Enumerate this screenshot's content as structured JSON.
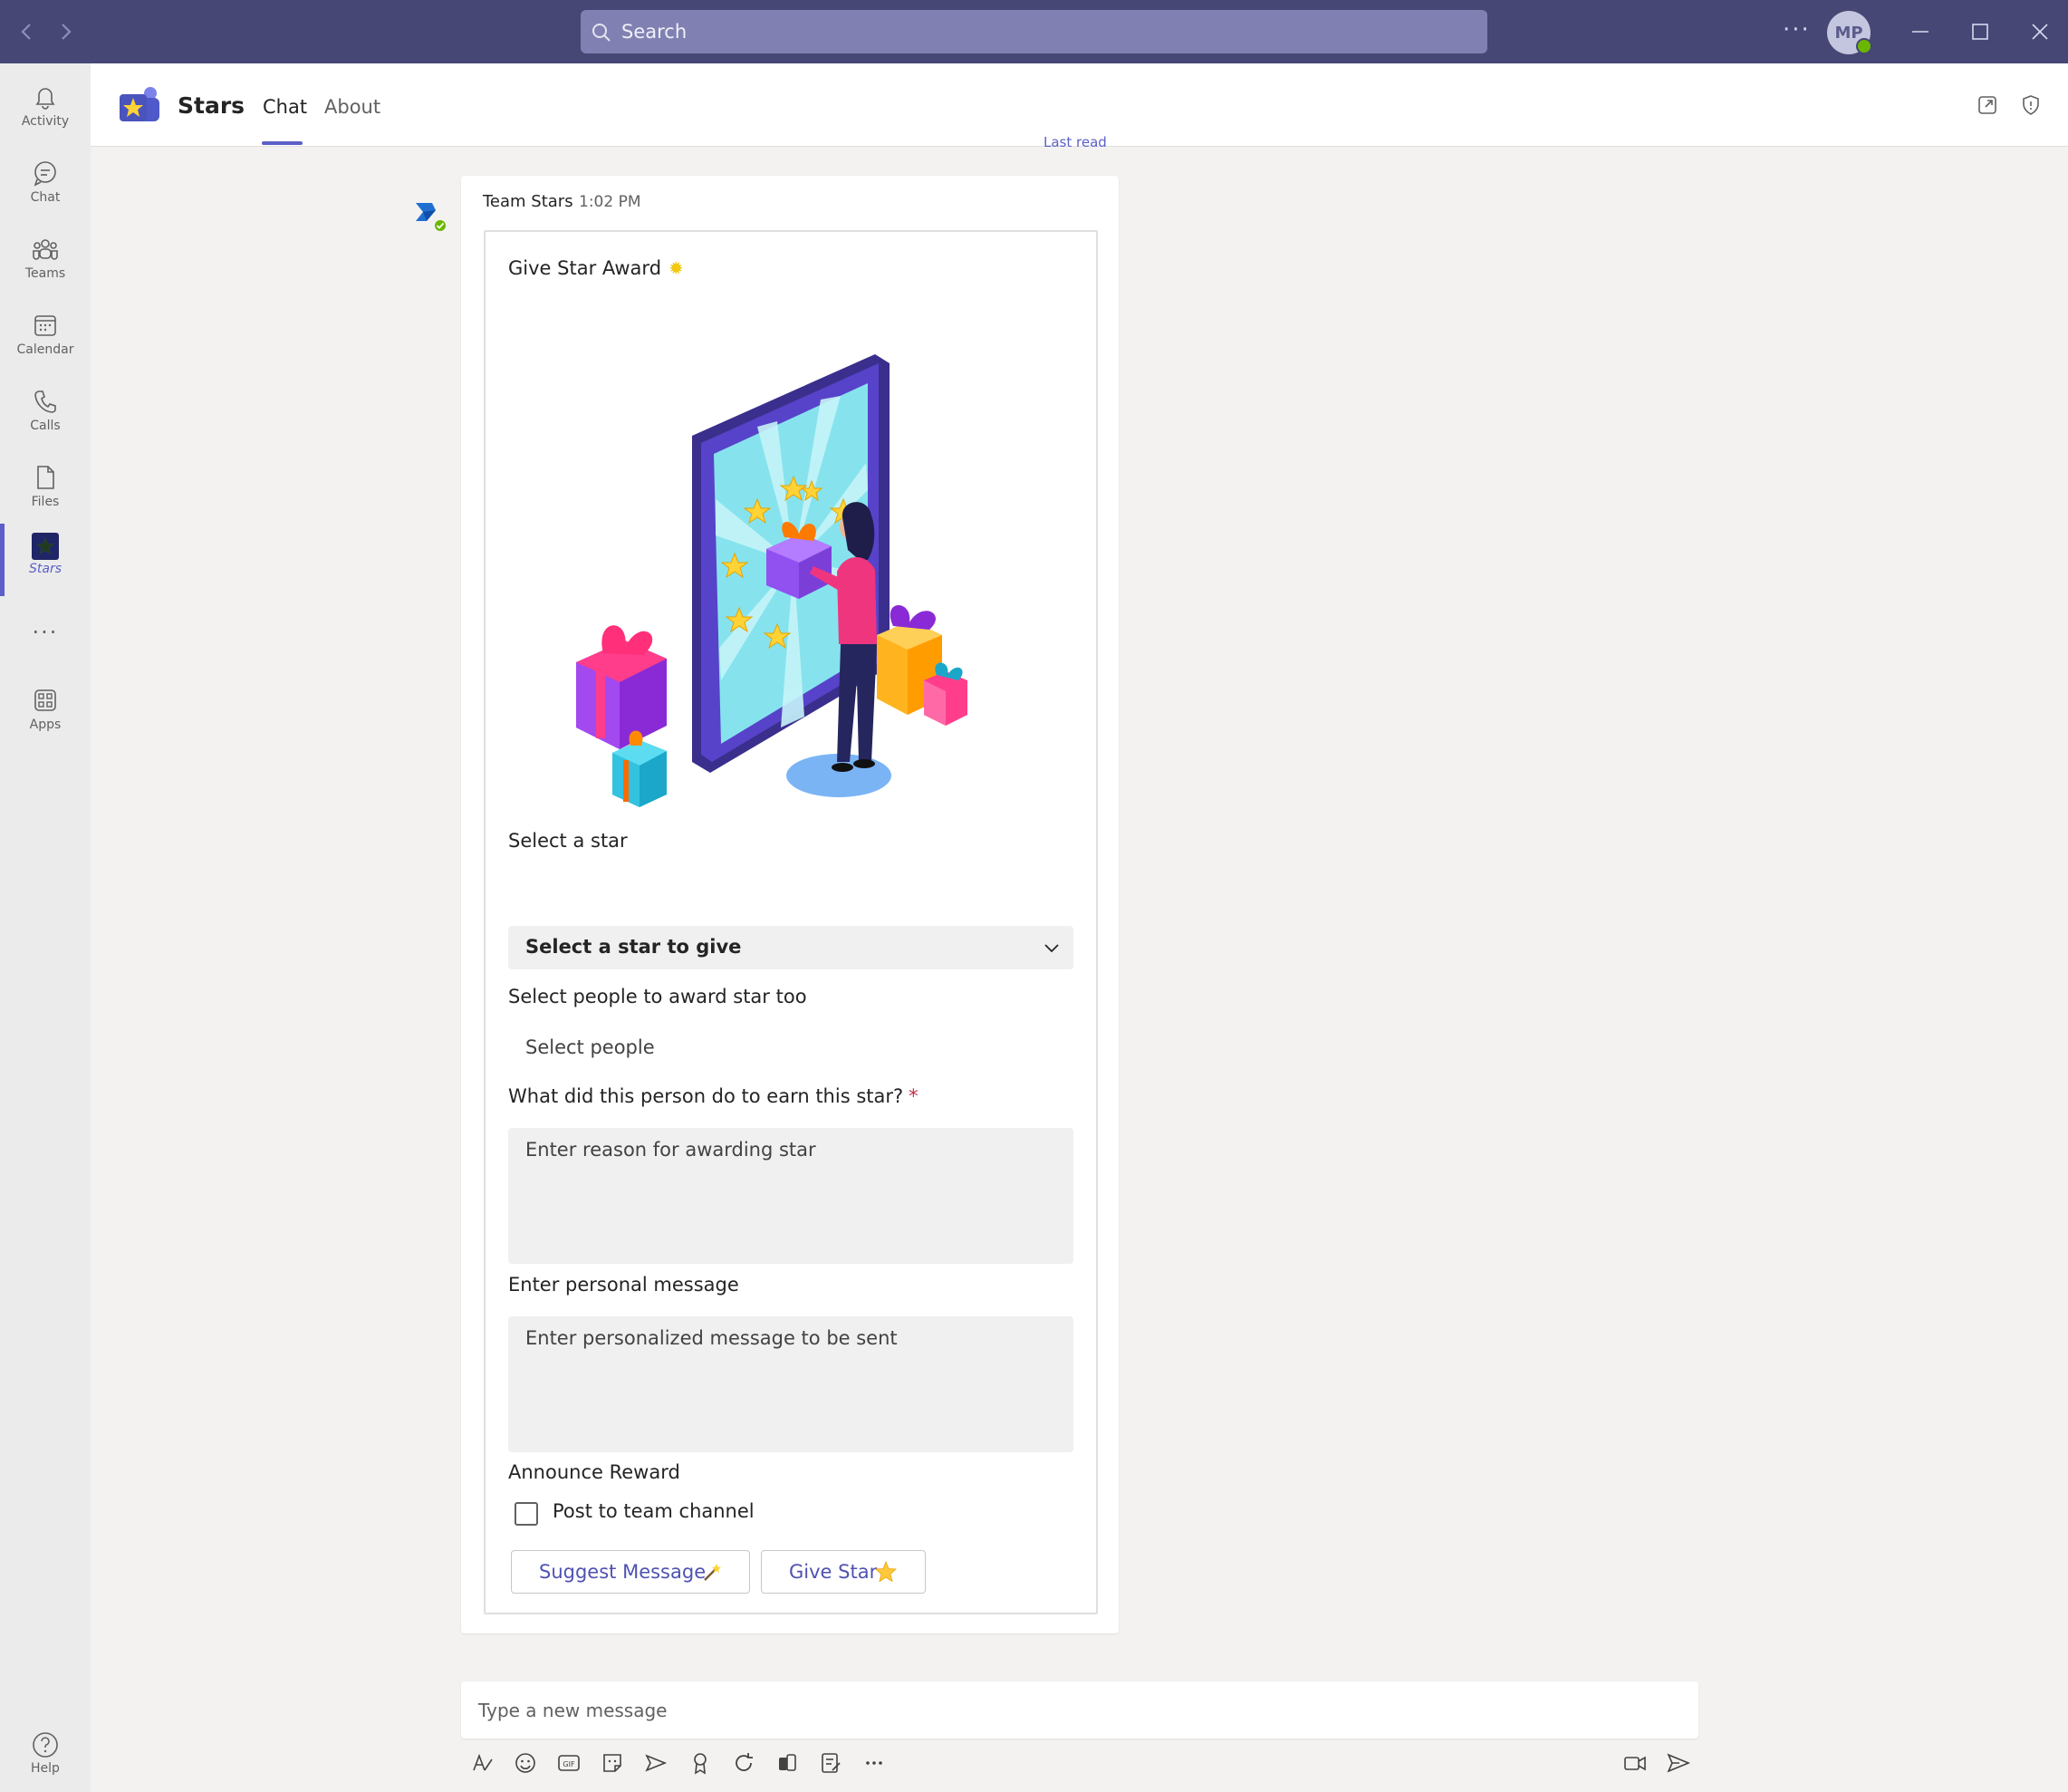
{
  "titlebar": {
    "search_placeholder": "Search",
    "avatar_initials": "MP"
  },
  "rail": {
    "items": [
      {
        "label": "Activity",
        "icon": "bell-icon"
      },
      {
        "label": "Chat",
        "icon": "chat-icon"
      },
      {
        "label": "Teams",
        "icon": "teams-icon"
      },
      {
        "label": "Calendar",
        "icon": "calendar-icon"
      },
      {
        "label": "Calls",
        "icon": "phone-icon"
      },
      {
        "label": "Files",
        "icon": "file-icon"
      },
      {
        "label": "Stars",
        "icon": "stars-app-icon"
      },
      {
        "label": "Apps",
        "icon": "apps-icon"
      }
    ],
    "help_label": "Help"
  },
  "header": {
    "app_name": "Stars",
    "tabs": [
      {
        "label": "Chat"
      },
      {
        "label": "About"
      }
    ]
  },
  "chat": {
    "last_read": "Last read",
    "message": {
      "sender": "Team Stars",
      "time": "1:02 PM"
    }
  },
  "card": {
    "title": "Give Star Award",
    "select_star_label": "Select a star",
    "select_star_value": "Select a star to give",
    "people_label": "Select people to award star too",
    "people_placeholder": "Select people",
    "reason_label": "What did this person do to earn this star?",
    "reason_required": "*",
    "reason_placeholder": "Enter reason for awarding star",
    "personal_label": "Enter personal message",
    "personal_placeholder": "Enter personalized message to be sent",
    "announce_label": "Announce Reward",
    "post_checkbox_label": "Post to team channel",
    "post_checked": false,
    "suggest_button": "Suggest Message",
    "give_button": "Give Star"
  },
  "compose": {
    "placeholder": "Type a new message"
  },
  "colors": {
    "titlebar": "#464775",
    "accent": "#5b5fc7",
    "button_text": "#4f52b2"
  }
}
